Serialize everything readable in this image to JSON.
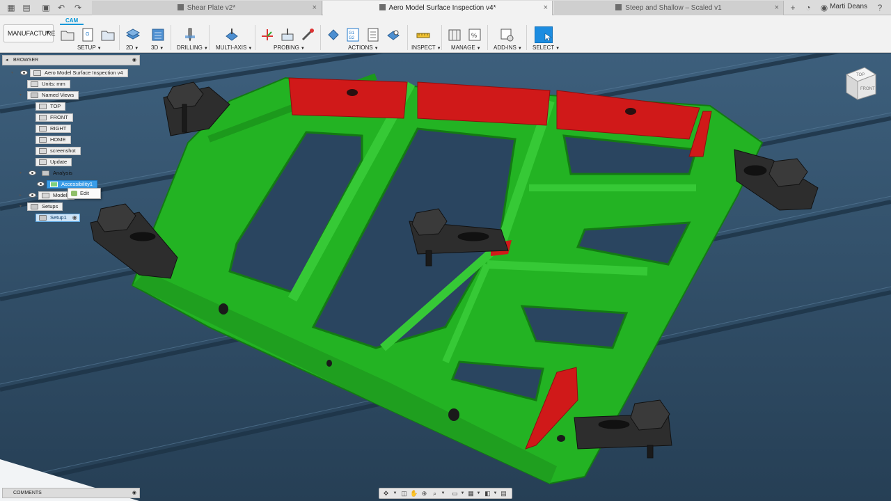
{
  "titlebar": {
    "tabs": [
      {
        "label": "Shear Plate v2*",
        "active": false
      },
      {
        "label": "Aero Model Surface Inspection v4*",
        "active": true
      },
      {
        "label": "Steep and Shallow – Scaled v1",
        "active": false
      }
    ],
    "close_glyph": "×",
    "new_tab_glyph": "+",
    "user": "Marti Deans"
  },
  "ribbon": {
    "workspace": "MANUFACTURE",
    "active_tab": "CAM",
    "groups": [
      "SETUP",
      "2D",
      "3D",
      "DRILLING",
      "MULTI-AXIS",
      "PROBING",
      "ACTIONS",
      "INSPECT",
      "MANAGE",
      "ADD-INS",
      "SELECT"
    ],
    "accent_color": "#0696d7"
  },
  "browser": {
    "title": "BROWSER",
    "root": "Aero Model Surface Inspection v4",
    "units": "Units: mm",
    "named_views": "Named Views",
    "views": [
      "TOP",
      "FRONT",
      "RIGHT",
      "HOME",
      "screenshot",
      "Update"
    ],
    "analysis": "Analysis",
    "analysis_item": "Accessibility1",
    "models": "Models",
    "setups": "Setups",
    "setup_item": "Setup1"
  },
  "context_menu": {
    "edit": "Edit"
  },
  "comments": {
    "title": "COMMENTS"
  },
  "viewcube": {
    "top": "TOP",
    "front": "FRONT"
  },
  "colors": {
    "accessible": "#22b522",
    "inaccessible": "#d01919",
    "table": "#2d4a62",
    "clamp": "#2b2b2b"
  }
}
